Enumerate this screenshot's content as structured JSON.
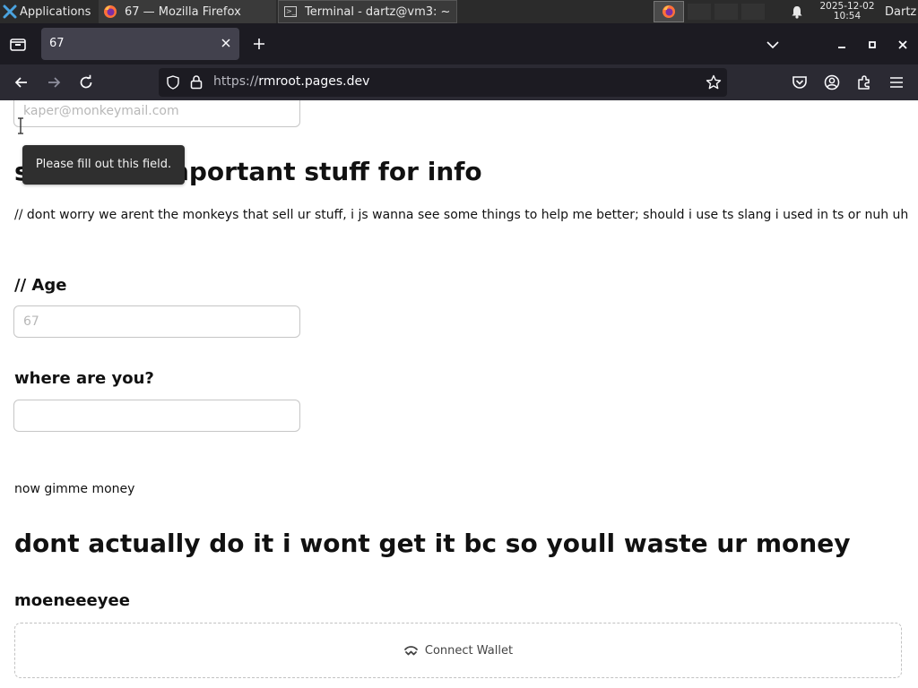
{
  "taskbar": {
    "applications_label": "Applications",
    "window1_title": "67 — Mozilla Firefox",
    "window2_title": "Terminal - dartz@vm3: ~",
    "clock_date": "2025-12-02",
    "clock_time": "10:54",
    "user": "Dartz"
  },
  "browser": {
    "tab_title": "67",
    "url_scheme": "https://",
    "url_host": "rmroot.pages.dev"
  },
  "page": {
    "email_placeholder": "kaper@monkeymail.com",
    "tooltip_text": "Please fill out this field.",
    "section_heading": "some not important stuff for info",
    "paragraph": "// dont worry we arent the monkeys that sell ur stuff, i js wanna see some things to help me better; should i use ts slang i used in ts or nuh uh",
    "age_label": "// Age",
    "age_placeholder": "67",
    "where_label": "where are you?",
    "money_text": "now gimme money",
    "warning_heading": "dont actually do it i wont get it bc so youll waste ur money",
    "money_label": "moeneeeyee",
    "connect_wallet_label": "Connect Wallet"
  },
  "colors": {
    "taskbar_bg": "#2b2b2b",
    "tabstrip_bg": "#1c1b22",
    "active_tab_bg": "#42414d",
    "navbar_bg": "#2b2a33",
    "tooltip_bg": "#2f2f2f"
  }
}
